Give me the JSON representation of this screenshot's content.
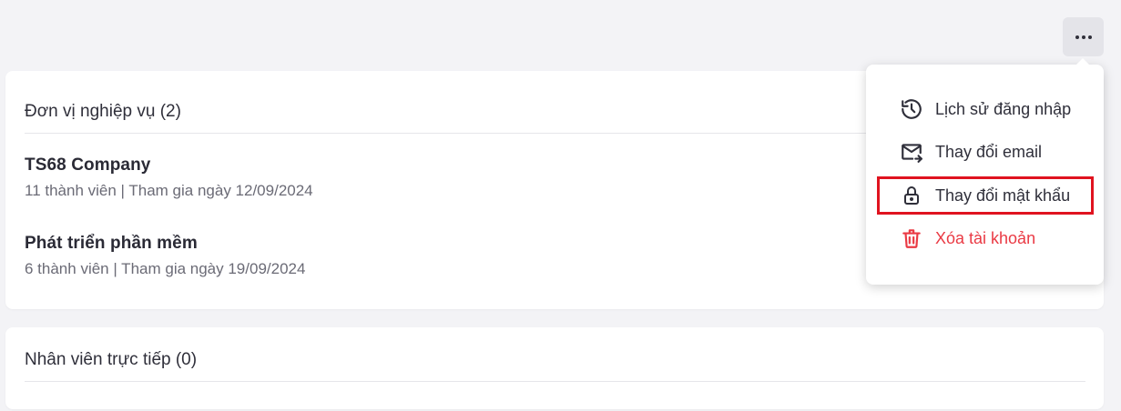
{
  "more_button": {
    "icon": "more-horizontal-icon"
  },
  "units_card": {
    "title": "Đơn vị nghiệp vụ (2)",
    "units": [
      {
        "name": "TS68 Company",
        "meta": "11 thành viên | Tham gia ngày 12/09/2024"
      },
      {
        "name": "Phát triển phần mềm",
        "meta": "6 thành viên | Tham gia ngày 19/09/2024"
      }
    ]
  },
  "staff_card": {
    "title": "Nhân viên trực tiếp (0)"
  },
  "menu": {
    "items": [
      {
        "label": "Lịch sử đăng nhập",
        "icon": "history-icon"
      },
      {
        "label": "Thay đổi email",
        "icon": "mail-forward-icon"
      },
      {
        "label": "Thay đổi mật khẩu",
        "icon": "lock-icon",
        "highlighted": true
      },
      {
        "label": "Xóa tài khoản",
        "icon": "trash-icon",
        "color": "#ea3a44"
      }
    ],
    "highlight_color": "#e0131f"
  }
}
